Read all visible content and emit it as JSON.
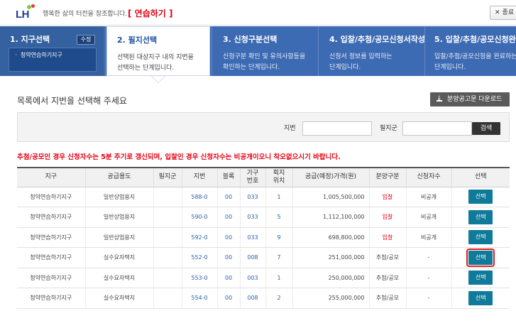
{
  "header": {
    "logo_text": "LH",
    "slogan": "행복한 삶의 터전을 창조합니다.",
    "practice_label": "[ 연습하기 ]",
    "end_button": "종료"
  },
  "steps": [
    {
      "title": "1. 지구선택",
      "modify_label": "수정",
      "selected": "ㆍ 청약연습하기지구"
    },
    {
      "title": "2. 필지선택",
      "desc1": "선택된 대상지구 내의 지번을",
      "desc2": "선택하는 단계입니다."
    },
    {
      "title": "3. 신청구분선택",
      "desc1": "신청구분 확인 및 유의사항등을",
      "desc2": "확인하는 단계입니다."
    },
    {
      "title": "4. 입찰/추첨/공모신청서작성",
      "desc1": "신청서 정보를 입력하는",
      "desc2": "단계입니다."
    },
    {
      "title": "5. 입찰/추첨/공모신청완료",
      "desc1": "입찰/추첨/공모신청을 완료하는",
      "desc2": "단계입니다."
    }
  ],
  "main": {
    "list_title": "목록에서 지번을 선택해 주세요",
    "download_button": "분양공고문 다운로드",
    "search": {
      "jibun_label": "지번",
      "piljigun_label": "필지군",
      "search_button": "검색"
    },
    "notice": "추첨/공모인 경우 신청자수는 5분 주기로 갱신되며, 입찰인 경우 신청자수는 비공개이오니 착오없으시기 바랍니다."
  },
  "table": {
    "headers": [
      "지구",
      "공급용도",
      "필지군",
      "지번",
      "블록",
      "가구\n번호",
      "획지\n위치",
      "공급(예정)가격(원)",
      "분양구분",
      "신청자수",
      "선택"
    ],
    "rows": [
      {
        "district": "청약연습하기지구",
        "usage": "일반상업용지",
        "group": "",
        "jibun": "588-0",
        "block": "00",
        "unit": "033",
        "lot": "1",
        "price": "1,005,500,000",
        "type": "입찰",
        "applicants": "비공개",
        "select": "선택"
      },
      {
        "district": "청약연습하기지구",
        "usage": "일반상업용지",
        "group": "",
        "jibun": "590-0",
        "block": "00",
        "unit": "033",
        "lot": "5",
        "price": "1,112,100,000",
        "type": "입찰",
        "applicants": "비공개",
        "select": "선택"
      },
      {
        "district": "청약연습하기지구",
        "usage": "일반상업용지",
        "group": "",
        "jibun": "592-0",
        "block": "00",
        "unit": "033",
        "lot": "9",
        "price": "698,800,000",
        "type": "입찰",
        "applicants": "비공개",
        "select": "선택"
      },
      {
        "district": "청약연습하기지구",
        "usage": "실수요자택지",
        "group": "",
        "jibun": "552-0",
        "block": "00",
        "unit": "008",
        "lot": "7",
        "price": "251,000,000",
        "type": "추첨/공모",
        "applicants": "-",
        "select": "선택"
      },
      {
        "district": "청약연습하기지구",
        "usage": "실수요자택지",
        "group": "",
        "jibun": "553-0",
        "block": "00",
        "unit": "003",
        "lot": "1",
        "price": "250,000,000",
        "type": "추첨/공모",
        "applicants": "-",
        "select": "선택"
      },
      {
        "district": "청약연습하기지구",
        "usage": "실수요자택지",
        "group": "",
        "jibun": "554-0",
        "block": "00",
        "unit": "008",
        "lot": "2",
        "price": "255,000,000",
        "type": "추첨/공모",
        "applicants": "-",
        "select": "선택"
      }
    ]
  },
  "colors": {
    "step_bar": "#3d6bb3",
    "select_button": "#0f7a9a",
    "notice_red": "#e60012",
    "jibun_blue": "#2a5fa8",
    "highlight_outline": "#e01b1b"
  }
}
